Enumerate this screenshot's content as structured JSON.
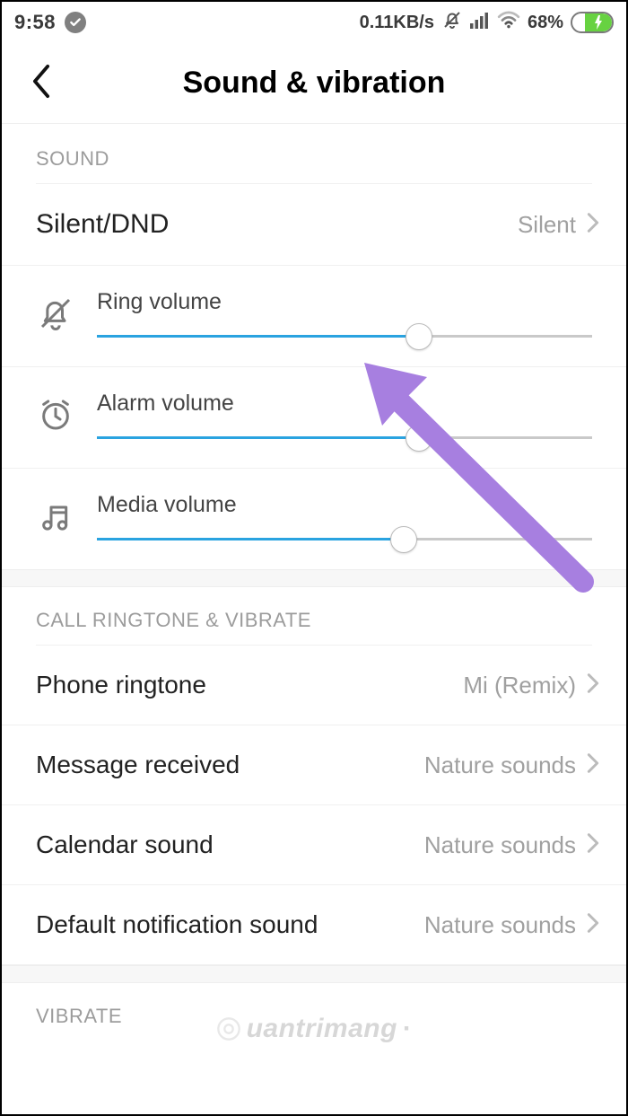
{
  "statusbar": {
    "time": "9:58",
    "network_speed": "0.11KB/s",
    "battery_pct": "68%"
  },
  "header": {
    "title": "Sound & vibration"
  },
  "sections": {
    "sound": {
      "header": "SOUND"
    },
    "call": {
      "header": "CALL RINGTONE & VIBRATE"
    },
    "vibrate": {
      "header": "VIBRATE"
    }
  },
  "rows": {
    "silentdnd": {
      "label": "Silent/DND",
      "value": "Silent"
    },
    "phone_ringtone": {
      "label": "Phone ringtone",
      "value": "Mi (Remix)"
    },
    "message_received": {
      "label": "Message received",
      "value": "Nature sounds"
    },
    "calendar_sound": {
      "label": "Calendar sound",
      "value": "Nature sounds"
    },
    "default_notification": {
      "label": "Default notification sound",
      "value": "Nature sounds"
    }
  },
  "sliders": {
    "ring": {
      "label": "Ring volume",
      "percent": 65
    },
    "alarm": {
      "label": "Alarm volume",
      "percent": 65
    },
    "media": {
      "label": "Media volume",
      "percent": 62
    }
  },
  "watermark": "uantrimang"
}
